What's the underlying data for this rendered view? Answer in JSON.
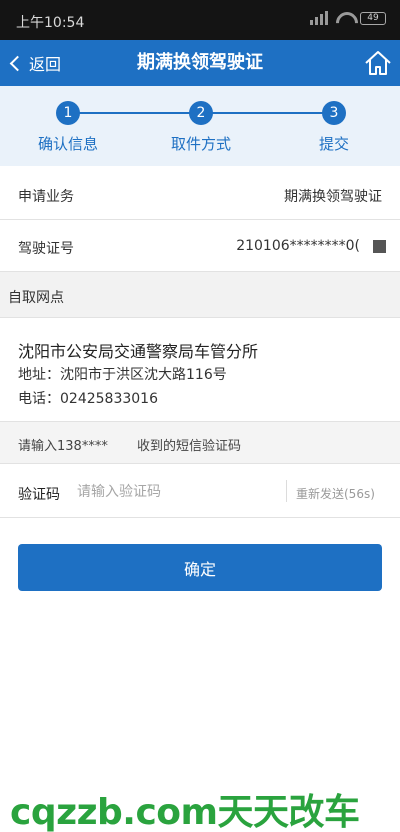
{
  "status_bar": {
    "time": "上午10:54",
    "battery": "49"
  },
  "nav": {
    "back_label": "返回",
    "title": "期满换领驾驶证"
  },
  "steps": [
    {
      "number": "1",
      "label": "确认信息"
    },
    {
      "number": "2",
      "label": "取件方式"
    },
    {
      "number": "3",
      "label": "提交"
    }
  ],
  "form": {
    "business_label": "申请业务",
    "business_value": "期满换领驾驶证",
    "license_label": "驾驶证号",
    "license_value": "210106********0("
  },
  "pickup": {
    "section_title": "自取网点",
    "station_name": "沈阳市公安局交通警察局车管分所",
    "address": "地址：沈阳市于洪区沈大路116号",
    "phone": "电话：02425833016"
  },
  "sms": {
    "hint_prefix": "请输入138****",
    "hint_suffix": "收到的短信验证码",
    "code_label": "验证码",
    "code_placeholder": "请输入验证码",
    "code_value": "",
    "resend_label": "重新发送(56s)"
  },
  "confirm_label": "确定",
  "watermark": "cqzzb.com天天改车",
  "colors": {
    "primary": "#1e70c3",
    "step_bg": "#eaf2fa",
    "watermark": "#2aa33e"
  },
  "icons": {
    "back": "chevron-left-icon",
    "home": "home-icon"
  }
}
